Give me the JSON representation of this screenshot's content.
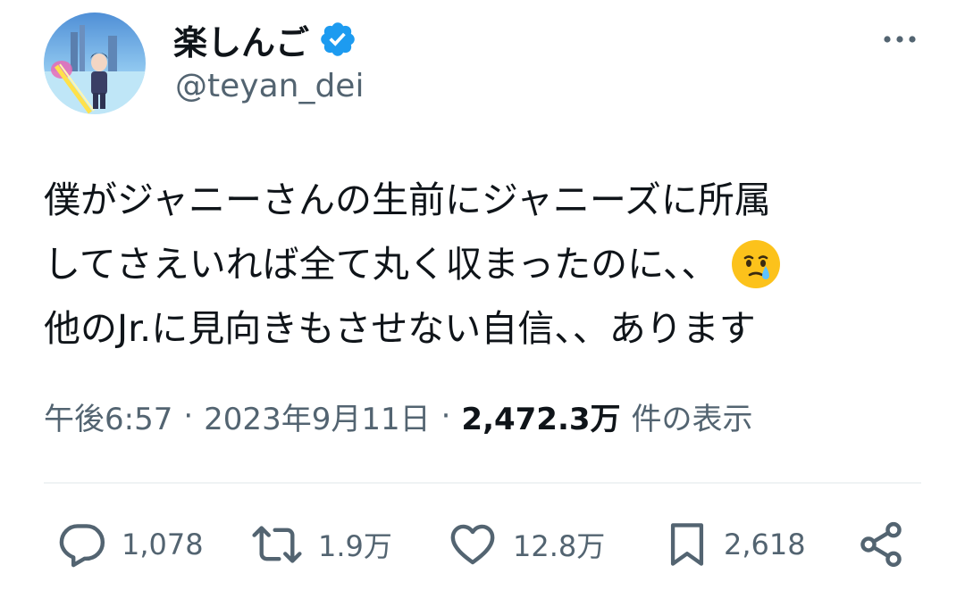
{
  "author": {
    "display_name": "楽しんご",
    "handle": "@teyan_dei",
    "verified": true
  },
  "tweet": {
    "text_lines": [
      "僕がジャニーさんの生前にジャニーズに所属",
      "してさえいれば全て丸く収まったのに、、",
      "他のJr.に見向きもさせない自信、、あります"
    ],
    "emoji": "face-holding-back-tears",
    "time": "午後6:57",
    "separator": "·",
    "date": "2023年9月11日",
    "views_count": "2,472.3万",
    "views_label": "件の表示"
  },
  "actions": {
    "replies": "1,078",
    "retweets": "1.9万",
    "likes": "12.8万",
    "bookmarks": "2,618"
  },
  "icons": {
    "more": "more-dots-icon",
    "reply": "reply-icon",
    "retweet": "retweet-icon",
    "like": "heart-icon",
    "bookmark": "bookmark-icon",
    "share": "share-icon",
    "verified": "verified-badge-icon"
  },
  "colors": {
    "text_primary": "#0f1419",
    "text_secondary": "#536471",
    "verified_blue": "#1d9bf0",
    "divider": "#eff3f4"
  }
}
